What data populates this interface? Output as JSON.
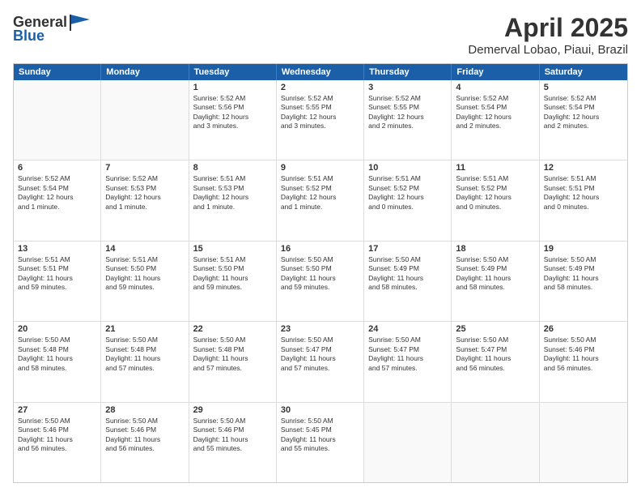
{
  "header": {
    "logo": {
      "general": "General",
      "blue": "Blue"
    },
    "title": "April 2025",
    "subtitle": "Demerval Lobao, Piaui, Brazil"
  },
  "calendar": {
    "days_of_week": [
      "Sunday",
      "Monday",
      "Tuesday",
      "Wednesday",
      "Thursday",
      "Friday",
      "Saturday"
    ],
    "rows": [
      [
        {
          "day": "",
          "info": ""
        },
        {
          "day": "",
          "info": ""
        },
        {
          "day": "1",
          "info": "Sunrise: 5:52 AM\nSunset: 5:56 PM\nDaylight: 12 hours\nand 3 minutes."
        },
        {
          "day": "2",
          "info": "Sunrise: 5:52 AM\nSunset: 5:55 PM\nDaylight: 12 hours\nand 3 minutes."
        },
        {
          "day": "3",
          "info": "Sunrise: 5:52 AM\nSunset: 5:55 PM\nDaylight: 12 hours\nand 2 minutes."
        },
        {
          "day": "4",
          "info": "Sunrise: 5:52 AM\nSunset: 5:54 PM\nDaylight: 12 hours\nand 2 minutes."
        },
        {
          "day": "5",
          "info": "Sunrise: 5:52 AM\nSunset: 5:54 PM\nDaylight: 12 hours\nand 2 minutes."
        }
      ],
      [
        {
          "day": "6",
          "info": "Sunrise: 5:52 AM\nSunset: 5:54 PM\nDaylight: 12 hours\nand 1 minute."
        },
        {
          "day": "7",
          "info": "Sunrise: 5:52 AM\nSunset: 5:53 PM\nDaylight: 12 hours\nand 1 minute."
        },
        {
          "day": "8",
          "info": "Sunrise: 5:51 AM\nSunset: 5:53 PM\nDaylight: 12 hours\nand 1 minute."
        },
        {
          "day": "9",
          "info": "Sunrise: 5:51 AM\nSunset: 5:52 PM\nDaylight: 12 hours\nand 1 minute."
        },
        {
          "day": "10",
          "info": "Sunrise: 5:51 AM\nSunset: 5:52 PM\nDaylight: 12 hours\nand 0 minutes."
        },
        {
          "day": "11",
          "info": "Sunrise: 5:51 AM\nSunset: 5:52 PM\nDaylight: 12 hours\nand 0 minutes."
        },
        {
          "day": "12",
          "info": "Sunrise: 5:51 AM\nSunset: 5:51 PM\nDaylight: 12 hours\nand 0 minutes."
        }
      ],
      [
        {
          "day": "13",
          "info": "Sunrise: 5:51 AM\nSunset: 5:51 PM\nDaylight: 11 hours\nand 59 minutes."
        },
        {
          "day": "14",
          "info": "Sunrise: 5:51 AM\nSunset: 5:50 PM\nDaylight: 11 hours\nand 59 minutes."
        },
        {
          "day": "15",
          "info": "Sunrise: 5:51 AM\nSunset: 5:50 PM\nDaylight: 11 hours\nand 59 minutes."
        },
        {
          "day": "16",
          "info": "Sunrise: 5:50 AM\nSunset: 5:50 PM\nDaylight: 11 hours\nand 59 minutes."
        },
        {
          "day": "17",
          "info": "Sunrise: 5:50 AM\nSunset: 5:49 PM\nDaylight: 11 hours\nand 58 minutes."
        },
        {
          "day": "18",
          "info": "Sunrise: 5:50 AM\nSunset: 5:49 PM\nDaylight: 11 hours\nand 58 minutes."
        },
        {
          "day": "19",
          "info": "Sunrise: 5:50 AM\nSunset: 5:49 PM\nDaylight: 11 hours\nand 58 minutes."
        }
      ],
      [
        {
          "day": "20",
          "info": "Sunrise: 5:50 AM\nSunset: 5:48 PM\nDaylight: 11 hours\nand 58 minutes."
        },
        {
          "day": "21",
          "info": "Sunrise: 5:50 AM\nSunset: 5:48 PM\nDaylight: 11 hours\nand 57 minutes."
        },
        {
          "day": "22",
          "info": "Sunrise: 5:50 AM\nSunset: 5:48 PM\nDaylight: 11 hours\nand 57 minutes."
        },
        {
          "day": "23",
          "info": "Sunrise: 5:50 AM\nSunset: 5:47 PM\nDaylight: 11 hours\nand 57 minutes."
        },
        {
          "day": "24",
          "info": "Sunrise: 5:50 AM\nSunset: 5:47 PM\nDaylight: 11 hours\nand 57 minutes."
        },
        {
          "day": "25",
          "info": "Sunrise: 5:50 AM\nSunset: 5:47 PM\nDaylight: 11 hours\nand 56 minutes."
        },
        {
          "day": "26",
          "info": "Sunrise: 5:50 AM\nSunset: 5:46 PM\nDaylight: 11 hours\nand 56 minutes."
        }
      ],
      [
        {
          "day": "27",
          "info": "Sunrise: 5:50 AM\nSunset: 5:46 PM\nDaylight: 11 hours\nand 56 minutes."
        },
        {
          "day": "28",
          "info": "Sunrise: 5:50 AM\nSunset: 5:46 PM\nDaylight: 11 hours\nand 56 minutes."
        },
        {
          "day": "29",
          "info": "Sunrise: 5:50 AM\nSunset: 5:46 PM\nDaylight: 11 hours\nand 55 minutes."
        },
        {
          "day": "30",
          "info": "Sunrise: 5:50 AM\nSunset: 5:45 PM\nDaylight: 11 hours\nand 55 minutes."
        },
        {
          "day": "",
          "info": ""
        },
        {
          "day": "",
          "info": ""
        },
        {
          "day": "",
          "info": ""
        }
      ]
    ]
  }
}
